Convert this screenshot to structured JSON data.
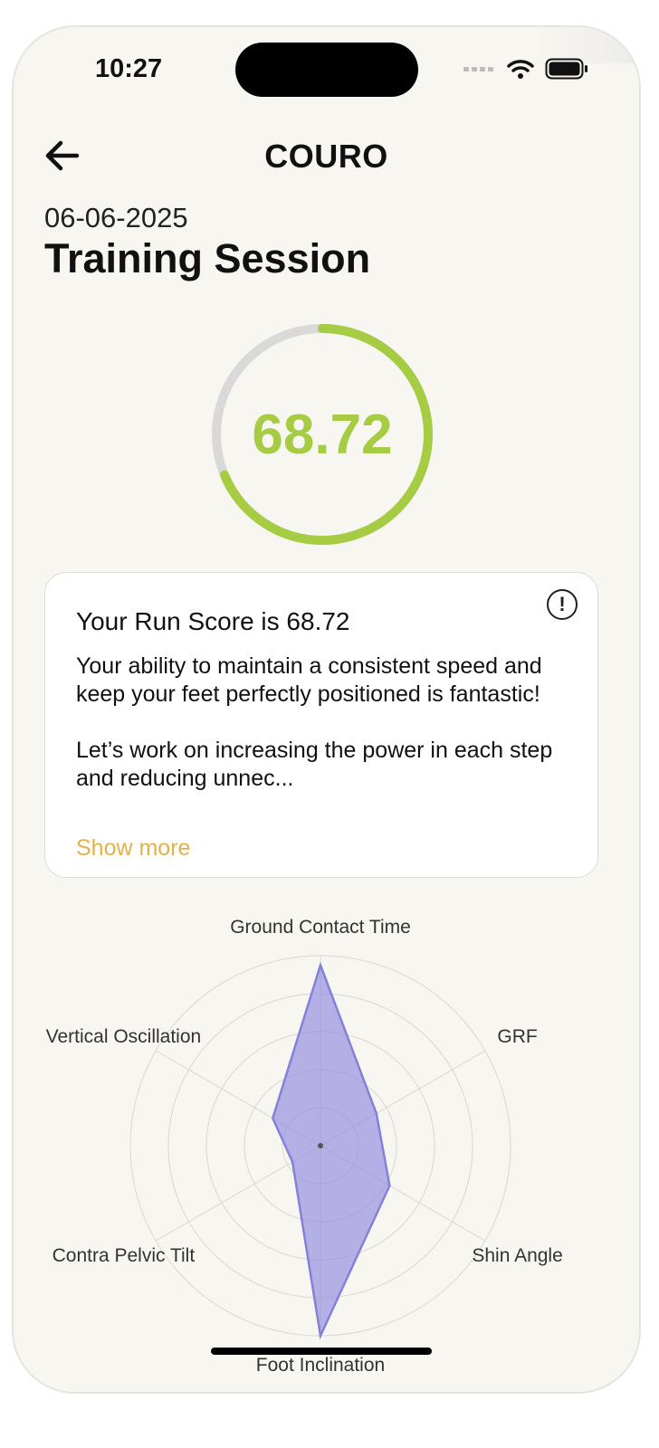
{
  "status_bar": {
    "time": "10:27"
  },
  "header": {
    "title": "COURO"
  },
  "session": {
    "date": "06-06-2025",
    "title": "Training Session"
  },
  "score": {
    "value": "68.72",
    "fraction": 0.6872,
    "ring_color": "#a6cc44",
    "track_color": "#d9d9d9"
  },
  "summary_card": {
    "title": "Your Run Score is 68.72",
    "paragraph_1": "Your ability to maintain a consistent speed and keep your feet perfectly positioned is fantastic!",
    "paragraph_2": "Let’s work on increasing the power in each step and reducing unnec...",
    "show_more": "Show more",
    "info_icon": "exclamation-circle-icon",
    "link_color": "#e2b14c"
  },
  "chart_data": {
    "type": "radar",
    "axes": [
      "Ground Contact Time",
      "GRF",
      "Shin Angle",
      "Foot Inclination",
      "Contra Pelvic Tilt",
      "Vertical Oscillation"
    ],
    "values": [
      0.95,
      0.34,
      0.42,
      1.0,
      0.17,
      0.29
    ],
    "rings": 5,
    "fill_color": "#8f8be0"
  }
}
